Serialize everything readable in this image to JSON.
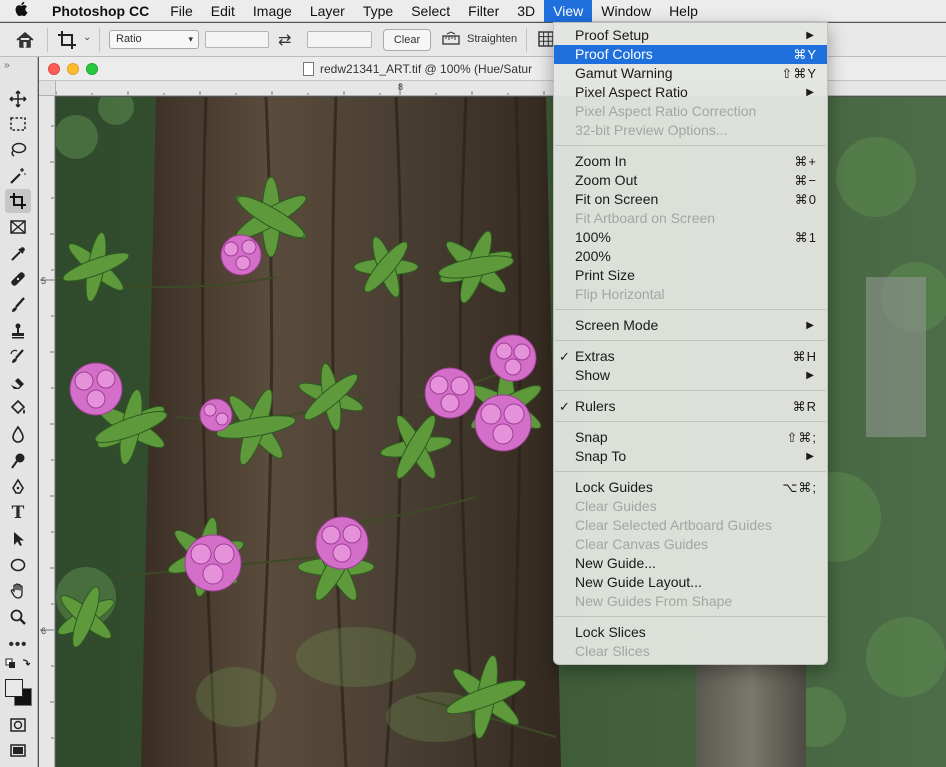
{
  "menubar": {
    "app": "Photoshop CC",
    "items": [
      "File",
      "Edit",
      "Image",
      "Layer",
      "Type",
      "Select",
      "Filter",
      "3D",
      "View",
      "Window",
      "Help"
    ],
    "active": "View"
  },
  "options": {
    "ratio_select": "Ratio",
    "clear_label": "Clear",
    "straighten_label": "Straighten"
  },
  "document": {
    "title": "redw21341_ART.tif @ 100% (Hue/Satur",
    "ruler_top": [
      "8"
    ],
    "ruler_left": [
      "5",
      "6"
    ]
  },
  "view_menu": {
    "proof_setup": "Proof Setup",
    "proof_colors": "Proof Colors",
    "proof_colors_sc": "⌘Y",
    "gamut_warning": "Gamut Warning",
    "gamut_warning_sc": "⇧⌘Y",
    "pixel_aspect_ratio": "Pixel Aspect Ratio",
    "pixel_aspect_correction": "Pixel Aspect Ratio Correction",
    "preview_32bit": "32-bit Preview Options...",
    "zoom_in": "Zoom In",
    "zoom_in_sc": "⌘+",
    "zoom_out": "Zoom Out",
    "zoom_out_sc": "⌘−",
    "fit_on_screen": "Fit on Screen",
    "fit_on_screen_sc": "⌘0",
    "fit_artboard": "Fit Artboard on Screen",
    "pct_100": "100%",
    "pct_100_sc": "⌘1",
    "pct_200": "200%",
    "print_size": "Print Size",
    "flip_horizontal": "Flip Horizontal",
    "screen_mode": "Screen Mode",
    "extras": "Extras",
    "extras_sc": "⌘H",
    "show": "Show",
    "rulers": "Rulers",
    "rulers_sc": "⌘R",
    "snap": "Snap",
    "snap_sc": "⇧⌘;",
    "snap_to": "Snap To",
    "lock_guides": "Lock Guides",
    "lock_guides_sc": "⌥⌘;",
    "clear_guides": "Clear Guides",
    "clear_artboard_guides": "Clear Selected Artboard Guides",
    "clear_canvas_guides": "Clear Canvas Guides",
    "new_guide": "New Guide...",
    "new_guide_layout": "New Guide Layout...",
    "new_guides_from_shape": "New Guides From Shape",
    "lock_slices": "Lock Slices",
    "clear_slices": "Clear Slices",
    "checkmark": "✓",
    "submenu_arrow": "▶"
  },
  "icons": {
    "apple": "apple-icon",
    "home": "home-icon",
    "crop": "crop-icon",
    "swap": "swap-icon",
    "straighten": "straighten-icon",
    "grid": "grid-overlay-icon"
  },
  "colors": {
    "highlight": "#1f6fdd",
    "flower": "#d46fc9"
  }
}
